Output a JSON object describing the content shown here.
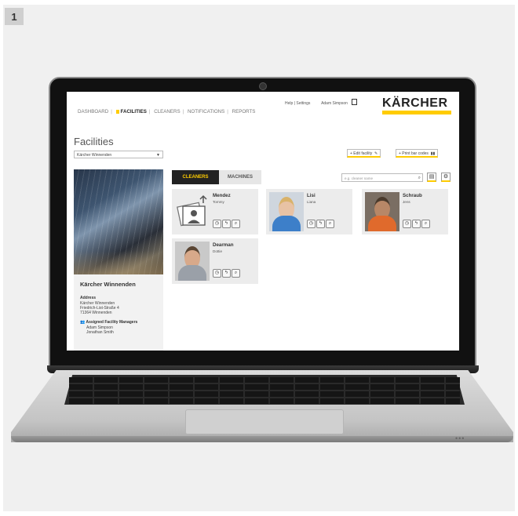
{
  "step_number": "1",
  "header": {
    "nav": [
      {
        "label": "DASHBOARD",
        "active": false
      },
      {
        "label": "FACILITIES",
        "active": true
      },
      {
        "label": "CLEANERS",
        "active": false
      },
      {
        "label": "NOTIFICATIONS",
        "active": false
      },
      {
        "label": "REPORTS",
        "active": false
      }
    ],
    "help_settings": "Help | Settings",
    "user_name": "Adam Simpson",
    "logo": "KÄRCHER"
  },
  "page": {
    "title": "Facilities",
    "facility_select": "Kärcher Winnenden",
    "edit_button": "+ Edit facility",
    "print_button": "+ Print bar codes"
  },
  "facility": {
    "name": "Kärcher Winnenden",
    "address_label": "Address",
    "address_lines": [
      "Kärcher Winnenden",
      "Friedrich-List-Straße 4",
      "71364 Winnenden"
    ],
    "managers_label": "Assigned Facility Managers",
    "managers": [
      "Adam Simpson",
      "Jonathan Smith"
    ]
  },
  "tabs": {
    "cleaners": "CLEANERS",
    "machines": "MACHINES"
  },
  "search": {
    "placeholder": "e.g. cleaner name"
  },
  "cleaners": [
    {
      "last": "Mendez",
      "first": "Tommy",
      "photo": "placeholder"
    },
    {
      "last": "Lisi",
      "first": "Liana",
      "photo": "woman"
    },
    {
      "last": "Schraub",
      "first": "Jens",
      "photo": "man"
    },
    {
      "last": "Dearman",
      "first": "Dottie",
      "photo": "man2"
    }
  ],
  "colors": {
    "accent": "#ffcc00",
    "tab_dark": "#222222"
  }
}
